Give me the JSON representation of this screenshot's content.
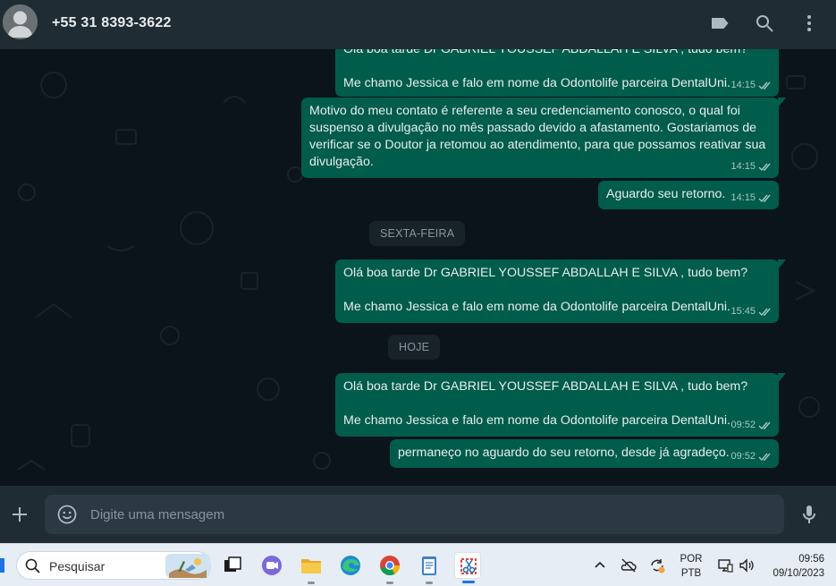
{
  "header": {
    "contact_name": "+55 31 8393-3622",
    "icons": [
      "avatar",
      "label-icon",
      "search-icon",
      "menu-icon"
    ]
  },
  "messages": [
    {
      "lines": [
        "Olá boa tarde Dr GABRIEL YOUSSEF ABDALLAH E SILVA , tudo bem?",
        "",
        "Me chamo Jessica e falo em nome da Odontolife parceira DentalUni."
      ],
      "time": "14:15",
      "status": "read"
    },
    {
      "lines": [
        "Motivo do meu contato é referente a seu credenciamento conosco, o qual foi",
        "suspenso a divulgação no mês passado devido a afastamento. Gostariamos de",
        "verificar se o Doutor ja retomou ao atendimento, para que possamos reativar sua",
        "divulgação."
      ],
      "time": "14:15",
      "status": "read"
    },
    {
      "lines": [
        "Aguardo seu retorno."
      ],
      "time": "14:15",
      "status": "read"
    },
    {
      "lines": [
        "Olá boa tarde Dr GABRIEL YOUSSEF ABDALLAH E SILVA , tudo bem?",
        "",
        "Me chamo Jessica e falo em nome da Odontolife parceira DentalUni."
      ],
      "time": "15:45",
      "status": "read"
    },
    {
      "lines": [
        "Olá boa tarde Dr GABRIEL YOUSSEF ABDALLAH E SILVA , tudo bem?",
        "",
        "Me chamo Jessica e falo em nome da Odontolife parceira DentalUni."
      ],
      "time": "09:52",
      "status": "read"
    },
    {
      "lines": [
        "permaneço no aguardo do seu retorno, desde já agradeço."
      ],
      "time": "09:52",
      "status": "read"
    }
  ],
  "day_separators": [
    "SEXTA-FEIRA",
    "HOJE"
  ],
  "composer": {
    "placeholder": "Digite uma mensagem"
  },
  "taskbar": {
    "search_label": "Pesquisar",
    "apps": [
      "task-view",
      "teams-chat",
      "file-explorer",
      "edge",
      "chrome",
      "notepad",
      "snipping-tool"
    ],
    "lang_line1": "POR",
    "lang_line2": "PTB",
    "time": "09:56",
    "date": "09/10/2023"
  },
  "colors": {
    "header_bg": "#202c33",
    "chat_bg": "#0b141a",
    "outgoing_bubble": "#005c4b",
    "text_primary": "#e9edef",
    "text_secondary": "#8696a0",
    "taskbar_bg": "#e6edf5"
  }
}
